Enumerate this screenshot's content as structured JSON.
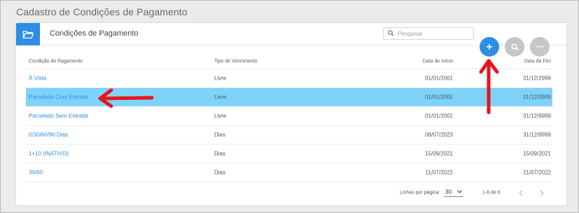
{
  "page": {
    "title": "Cadastro de Condições de Pagamento"
  },
  "header": {
    "title": "Condições de Pagamento",
    "search_placeholder": "Pesquisar"
  },
  "colors": {
    "accent": "#2e8de4",
    "selected_row": "#7ed3fb",
    "annotation": "#e8141a"
  },
  "table": {
    "columns": [
      "Condição de Pagamento",
      "Tipo de Vencimento",
      "Data de Início",
      "Data do Fim"
    ],
    "rows": [
      {
        "condicao": "À Vista",
        "tipo": "Livre",
        "inicio": "01/01/2001",
        "fim": "31/12/2999",
        "selected": false
      },
      {
        "condicao": "Parcelado Com Entrada",
        "tipo": "Livre",
        "inicio": "01/01/2001",
        "fim": "31/12/9999",
        "selected": true
      },
      {
        "condicao": "Parcelado Sem Entrada",
        "tipo": "Livre",
        "inicio": "01/01/2001",
        "fim": "31/12/9999",
        "selected": false
      },
      {
        "condicao": "0/30/60/90 Dias",
        "tipo": "Dias",
        "inicio": "08/07/2023",
        "fim": "31/12/9999",
        "selected": false
      },
      {
        "condicao": "1+10 (INATIVO)",
        "tipo": "Dias",
        "inicio": "15/09/2021",
        "fim": "15/09/2021",
        "selected": false
      },
      {
        "condicao": "30/60",
        "tipo": "Dias",
        "inicio": "11/07/2022",
        "fim": "21/07/2022",
        "selected": false
      }
    ]
  },
  "pagination": {
    "per_page_label": "Linhas por página:",
    "per_page_value": "30",
    "range": "1-6 de 6"
  },
  "icons": {
    "folder": "folder-open-icon",
    "search": "search-icon",
    "add": "plus-icon",
    "more": "more-horizontal-icon",
    "prev": "chevron-left-icon",
    "next": "chevron-right-icon",
    "dropdown": "caret-down-icon"
  }
}
